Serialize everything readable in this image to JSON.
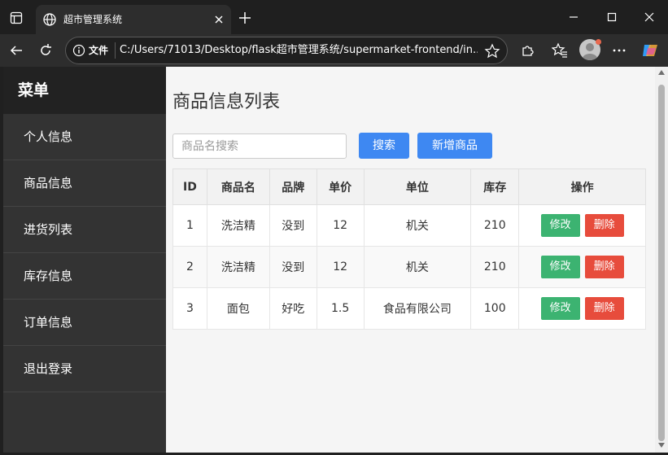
{
  "browser": {
    "tab_title": "超市管理系统",
    "address_label": "文件",
    "url": "C:/Users/71013/Desktop/flask超市管理系统/supermarket-frontend/in..."
  },
  "sidebar": {
    "title": "菜单",
    "items": [
      {
        "label": "个人信息"
      },
      {
        "label": "商品信息"
      },
      {
        "label": "进货列表"
      },
      {
        "label": "库存信息"
      },
      {
        "label": "订单信息"
      },
      {
        "label": "退出登录"
      }
    ]
  },
  "main": {
    "title": "商品信息列表",
    "search_placeholder": "商品名搜索",
    "search_button": "搜索",
    "add_button": "新增商品"
  },
  "table": {
    "headers": [
      "ID",
      "商品名",
      "品牌",
      "单价",
      "单位",
      "库存",
      "操作"
    ],
    "edit_label": "修改",
    "delete_label": "删除",
    "rows": [
      {
        "id": "1",
        "name": "洗洁精",
        "brand": "没到",
        "price": "12",
        "unit": "机关",
        "stock": "210"
      },
      {
        "id": "2",
        "name": "洗洁精",
        "brand": "没到",
        "price": "12",
        "unit": "机关",
        "stock": "210"
      },
      {
        "id": "3",
        "name": "面包",
        "brand": "好吃",
        "price": "1.5",
        "unit": "食品有限公司",
        "stock": "100"
      }
    ]
  },
  "colors": {
    "primary": "#3e88f2",
    "edit": "#3cb371",
    "delete": "#e74c3c",
    "sidebar": "#333333",
    "sidebar_header": "#222222"
  },
  "icons": [
    "tab-actions-icon",
    "globe-icon",
    "close-icon",
    "plus-icon",
    "minimize-icon",
    "maximize-icon",
    "back-icon",
    "reload-icon",
    "info-icon",
    "star-icon",
    "extensions-icon",
    "favorites-icon",
    "profile-avatar",
    "more-icon",
    "copilot-icon"
  ]
}
